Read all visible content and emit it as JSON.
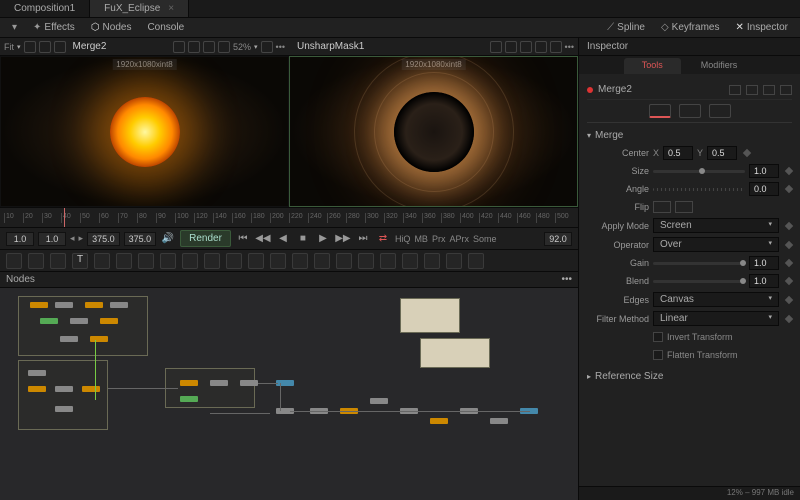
{
  "tabs": {
    "items": [
      "Composition1",
      "FuX_Eclipse"
    ],
    "active": 1
  },
  "toolbar": {
    "effects": "Effects",
    "nodes": "Nodes",
    "console": "Console",
    "spline": "Spline",
    "keyframes": "Keyframes",
    "inspector": "Inspector",
    "fit": "Fit",
    "zoom": "52%"
  },
  "viewers": {
    "left": {
      "name": "Merge2",
      "res": "1920x1080xint8"
    },
    "right": {
      "name": "UnsharpMask1",
      "res": "1920x1080xint8"
    }
  },
  "ruler": {
    "ticks": [
      "10",
      "20",
      "30",
      "40",
      "50",
      "60",
      "70",
      "80",
      "90",
      "100",
      "120",
      "140",
      "160",
      "180",
      "200",
      "220",
      "240",
      "260",
      "280",
      "300",
      "320",
      "340",
      "360",
      "380",
      "400",
      "420",
      "440",
      "460",
      "480",
      "500"
    ]
  },
  "transport": {
    "in": "1.0",
    "cur": "1.0",
    "out": "375.0",
    "total": "375.0",
    "render": "Render",
    "hiq": "HiQ",
    "mb": "MB",
    "prx": "Prx",
    "aprx": "APrx",
    "some": "Some",
    "end": "92.0"
  },
  "nodespanel": {
    "title": "Nodes",
    "menu": "•••"
  },
  "inspector": {
    "title": "Inspector",
    "tabs": {
      "tools": "Tools",
      "modifiers": "Modifiers"
    },
    "node": "Merge2",
    "section_merge": "Merge",
    "section_ref": "Reference Size",
    "props": {
      "center": "Center",
      "x": "X",
      "xval": "0.5",
      "y": "Y",
      "yval": "0.5",
      "size": "Size",
      "sizeval": "1.0",
      "angle": "Angle",
      "angleval": "0.0",
      "flip": "Flip",
      "applymode": "Apply Mode",
      "applymodev": "Screen",
      "operator": "Operator",
      "operatorv": "Over",
      "gain": "Gain",
      "gainv": "1.0",
      "blend": "Blend",
      "blendv": "1.0",
      "edges": "Edges",
      "edgesv": "Canvas",
      "filter": "Filter Method",
      "filterv": "Linear",
      "invert": "Invert Transform",
      "flatten": "Flatten Transform"
    }
  },
  "status": "12% – 997 MB  idle"
}
